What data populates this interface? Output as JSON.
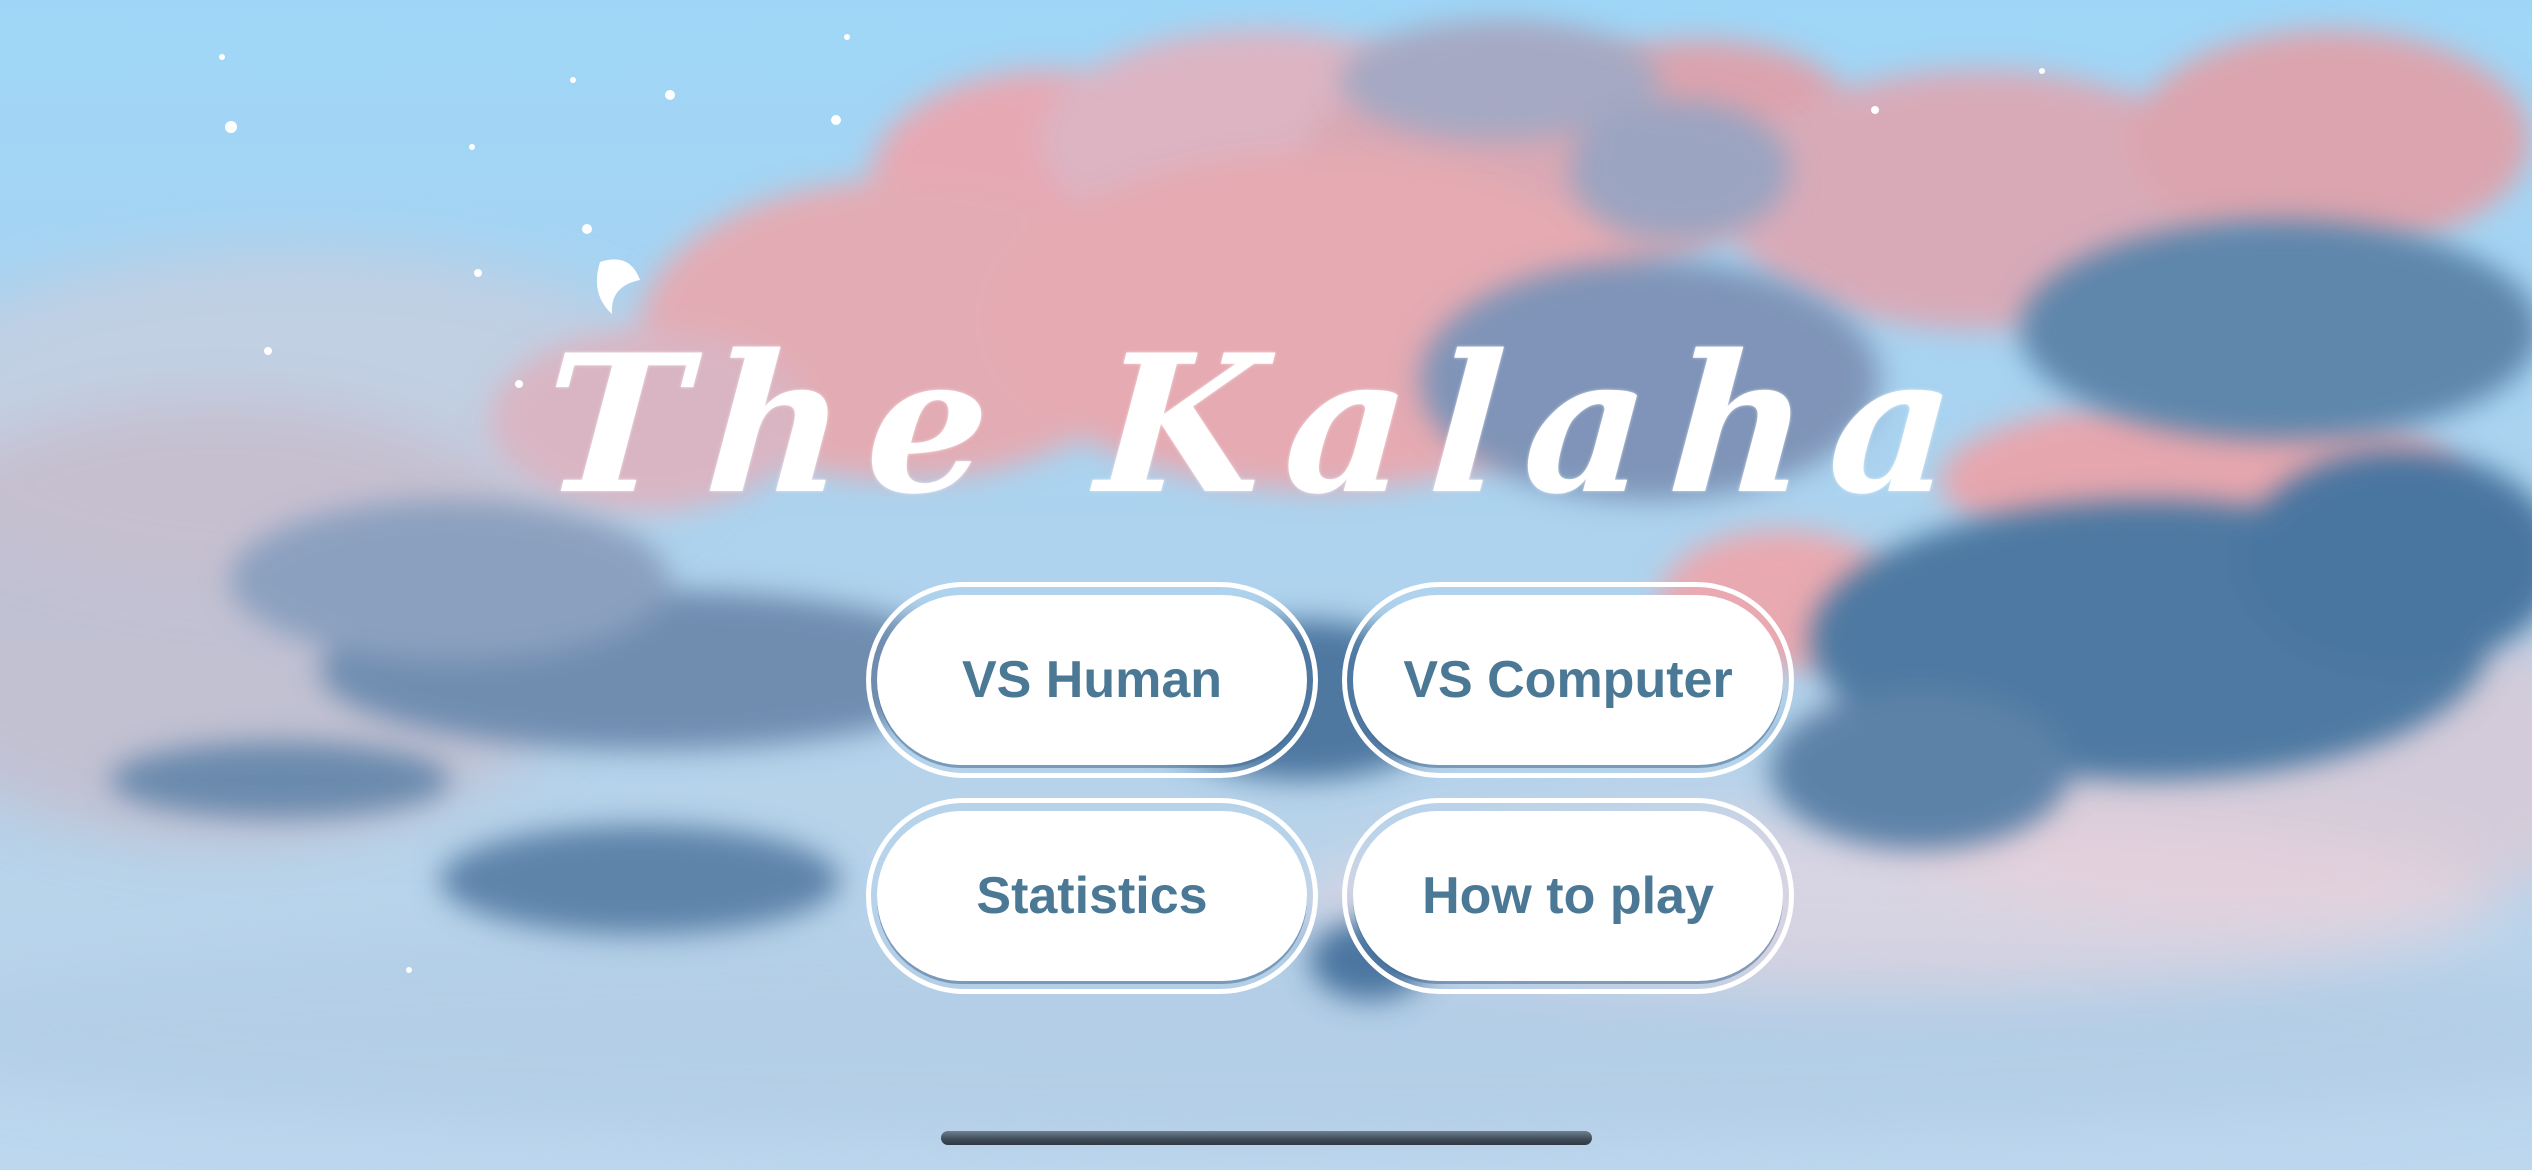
{
  "game": {
    "title": "The Kalaha"
  },
  "menu": {
    "vs_human": "VS Human",
    "vs_computer": "VS Computer",
    "statistics": "Statistics",
    "how_to_play": "How to play"
  },
  "colors": {
    "sky_top": "#9fd6f7",
    "cloud_pink": "#e4aab4",
    "cloud_blue": "#5a7fa3",
    "cloud_dark_blue": "#456f98",
    "button_text": "#4b7895",
    "button_fill": "#ffffff"
  }
}
